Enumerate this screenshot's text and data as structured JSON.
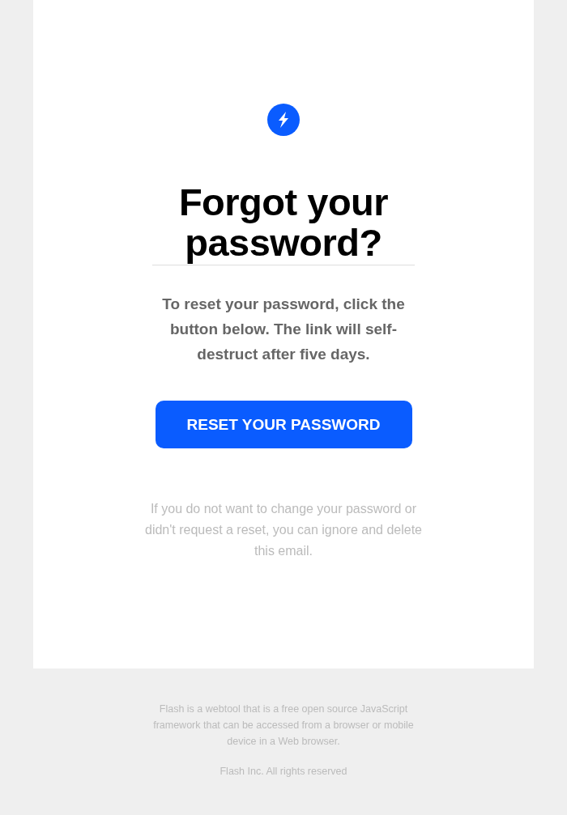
{
  "email": {
    "heading": "Forgot your password?",
    "message": "To reset your password, click the button below. The link will self-destruct after five days.",
    "button": "RESET YOUR PASSWORD",
    "note": "If you do not want to change your password or didn't request a reset, you can ignore and delete this email."
  },
  "footer": {
    "about": "Flash is a webtool that is a free open source JavaScript framework that can be accessed from a browser or mobile device in a Web browser.",
    "copyright": "Flash Inc. All rights reserved"
  }
}
